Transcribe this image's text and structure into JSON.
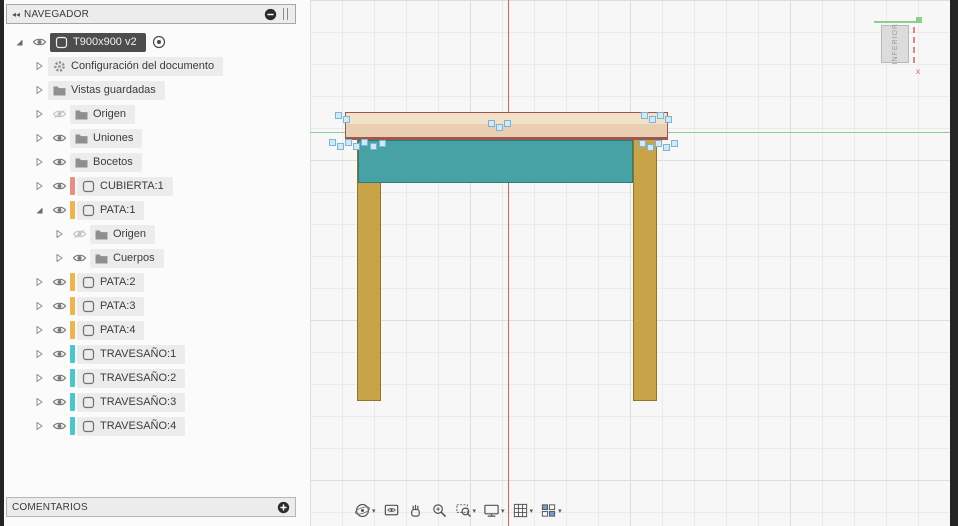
{
  "icons": {
    "collapse_panel": "◂◂",
    "dropdown_caret": "▾",
    "minimize_panel": "minus-circle",
    "add_comment": "plus-circle"
  },
  "navigator": {
    "title": "NAVEGADOR",
    "items": [
      {
        "label": "T900x900 v2",
        "indent": 0,
        "arrow": "expanded",
        "eye": "visible",
        "icon": "component",
        "root": true,
        "radio": true
      },
      {
        "label": "Configuración del documento",
        "indent": 1,
        "arrow": "collapsed",
        "icon": "gear"
      },
      {
        "label": "Vistas guardadas",
        "indent": 1,
        "arrow": "collapsed",
        "icon": "folder"
      },
      {
        "label": "Origen",
        "indent": 1,
        "arrow": "collapsed",
        "eye": "hidden",
        "icon": "folder"
      },
      {
        "label": "Uniones",
        "indent": 1,
        "arrow": "collapsed",
        "eye": "visible",
        "icon": "folder"
      },
      {
        "label": "Bocetos",
        "indent": 1,
        "arrow": "collapsed",
        "eye": "visible",
        "icon": "folder"
      },
      {
        "label": "CUBIERTA:1",
        "indent": 1,
        "arrow": "collapsed",
        "eye": "visible",
        "icon": "component",
        "color": "#ea8f80"
      },
      {
        "label": "PATA:1",
        "indent": 1,
        "arrow": "expanded",
        "eye": "visible",
        "icon": "component",
        "color": "#efb54b"
      },
      {
        "label": "Origen",
        "indent": 2,
        "arrow": "collapsed",
        "eye": "hidden",
        "icon": "folder"
      },
      {
        "label": "Cuerpos",
        "indent": 2,
        "arrow": "collapsed",
        "eye": "visible",
        "icon": "folder"
      },
      {
        "label": "PATA:2",
        "indent": 1,
        "arrow": "collapsed",
        "eye": "visible",
        "icon": "component",
        "color": "#efb54b"
      },
      {
        "label": "PATA:3",
        "indent": 1,
        "arrow": "collapsed",
        "eye": "visible",
        "icon": "component",
        "color": "#efb54b"
      },
      {
        "label": "PATA:4",
        "indent": 1,
        "arrow": "collapsed",
        "eye": "visible",
        "icon": "component",
        "color": "#efb54b"
      },
      {
        "label": "TRAVESAÑO:1",
        "indent": 1,
        "arrow": "collapsed",
        "eye": "visible",
        "icon": "component",
        "color": "#4ac6cc"
      },
      {
        "label": "TRAVESAÑO:2",
        "indent": 1,
        "arrow": "collapsed",
        "eye": "visible",
        "icon": "component",
        "color": "#4ac6cc"
      },
      {
        "label": "TRAVESAÑO:3",
        "indent": 1,
        "arrow": "collapsed",
        "eye": "visible",
        "icon": "component",
        "color": "#4ac6cc"
      },
      {
        "label": "TRAVESAÑO:4",
        "indent": 1,
        "arrow": "collapsed",
        "eye": "visible",
        "icon": "component",
        "color": "#4ac6cc"
      }
    ]
  },
  "comments": {
    "title": "COMENTARIOS"
  },
  "viewport": {
    "viewcube": {
      "label": "INFERIOR",
      "axis_x": "x"
    },
    "toolbar": [
      {
        "name": "orbit",
        "caret": true
      },
      {
        "name": "look-at",
        "caret": false
      },
      {
        "name": "pan",
        "caret": false
      },
      {
        "name": "zoom",
        "caret": false
      },
      {
        "name": "fit",
        "caret": true
      },
      {
        "name": "display-settings",
        "caret": true
      },
      {
        "name": "grid-display",
        "caret": true
      },
      {
        "name": "viewports",
        "caret": true
      }
    ]
  },
  "colors": {
    "top_fill_light": "#f2e1c9",
    "top_fill_dark": "#e9ceb2",
    "top_border": "#9c584e",
    "apron_fill": "#47a2a5",
    "apron_border": "#2e7a7d",
    "leg_fill": "#c9a347",
    "leg_border": "#8d7827",
    "axis_red": "#e05d5d",
    "axis_green": "#8ccf8c",
    "handle_fill": "#cfe9f7",
    "handle_border": "#7fb3d3",
    "selected_row_bg": "#4d4d4d",
    "swatch_cubierta": "#ea8f80",
    "swatch_pata": "#efb54b",
    "swatch_travesano": "#4ac6cc"
  }
}
